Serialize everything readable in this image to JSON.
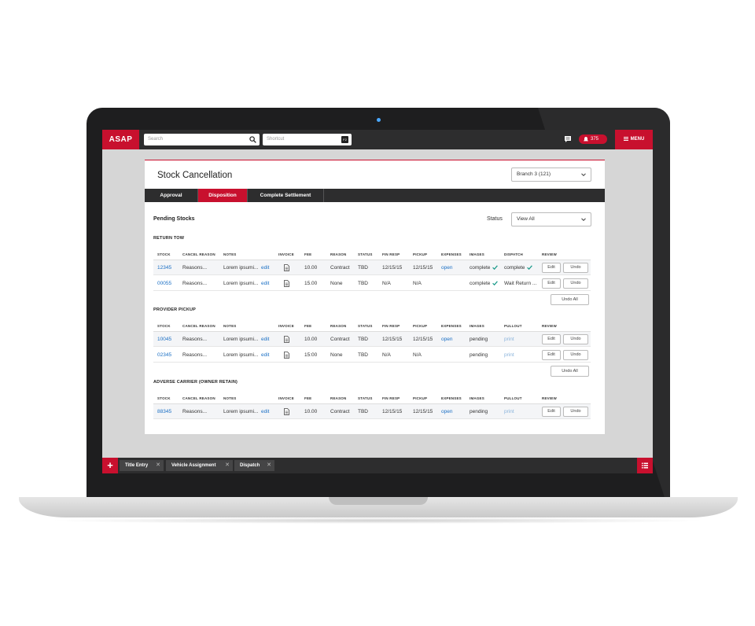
{
  "app": {
    "logo": "ASAP",
    "search_placeholder": "Search",
    "shortcut_placeholder": "Shortcut",
    "shortcut_key": "F2",
    "notification_count": "375",
    "menu_label": "MENU"
  },
  "page": {
    "title": "Stock Cancellation",
    "branch_value": "Branch 3 (121)",
    "tabs": [
      {
        "label": "Approval",
        "active": false
      },
      {
        "label": "Disposition",
        "active": true
      },
      {
        "label": "Complete Settlement",
        "active": false
      }
    ],
    "pending_title": "Pending Stocks",
    "status_label": "Status",
    "status_value": "View All"
  },
  "sections": [
    {
      "title": "RETURN TOW",
      "headers": [
        "STOCK",
        "CANCEL REASON",
        "NOTES",
        "INVOICE",
        "FEE",
        "REASON",
        "STATUS",
        "FIN RESP",
        "PICKUP",
        "EXPENSES",
        "IMAGES",
        "DISPATCH",
        "REVIEW"
      ],
      "rows": [
        {
          "stock": "12345",
          "cancel_reason": "Reasons...",
          "notes": "Lorem ipsumi...",
          "notes_edit": "edit",
          "fee": "10.00",
          "reason": "Contract",
          "status": "TBD",
          "fin_resp": "12/15/15",
          "pickup": "12/15/15",
          "expenses": "open",
          "images": "complete",
          "dispatch": "complete",
          "edit": "Edit",
          "undo": "Undo"
        },
        {
          "stock": "00055",
          "cancel_reason": "Reasons...",
          "notes": "Lorem ipsumi...",
          "notes_edit": "edit",
          "fee": "15.00",
          "reason": "None",
          "status": "TBD",
          "fin_resp": "N/A",
          "pickup": "N/A",
          "expenses": "",
          "images": "complete",
          "dispatch": "Wait Return ...",
          "edit": "Edit",
          "undo": "Undo"
        }
      ],
      "undo_all": "Undo All"
    },
    {
      "title": "PROVIDER PICKUP",
      "headers": [
        "STOCK",
        "CANCEL REASON",
        "NOTES",
        "INVOICE",
        "FEE",
        "REASON",
        "STATUS",
        "FIN RESP",
        "PICKUP",
        "EXPENSES",
        "IMAGES",
        "PULLOUT",
        "REVIEW"
      ],
      "rows": [
        {
          "stock": "10045",
          "cancel_reason": "Reasons...",
          "notes": "Lorem ipsumi...",
          "notes_edit": "edit",
          "fee": "10.00",
          "reason": "Contract",
          "status": "TBD",
          "fin_resp": "12/15/15",
          "pickup": "12/15/15",
          "expenses": "open",
          "images": "pending",
          "pullout": "print",
          "edit": "Edit",
          "undo": "Undo"
        },
        {
          "stock": "02345",
          "cancel_reason": "Reasons...",
          "notes": "Lorem ipsumi...",
          "notes_edit": "edit",
          "fee": "15:00",
          "reason": "None",
          "status": "TBD",
          "fin_resp": "N/A",
          "pickup": "N/A",
          "expenses": "",
          "images": "pending",
          "pullout": "print",
          "edit": "Edit",
          "undo": "Undo"
        }
      ],
      "undo_all": "Undo All"
    },
    {
      "title": "ADVERSE CARRIER (OWNER RETAIN)",
      "headers": [
        "STOCK",
        "CANCEL REASON",
        "NOTES",
        "INVOICE",
        "FEE",
        "REASON",
        "STATUS",
        "FIN RESP",
        "PICKUP",
        "EXPENSES",
        "IMAGES",
        "PULLOUT",
        "REVIEW"
      ],
      "rows": [
        {
          "stock": "88345",
          "cancel_reason": "Reasons...",
          "notes": "Lorem ipsumi...",
          "notes_edit": "edit",
          "fee": "10.00",
          "reason": "Contract",
          "status": "TBD",
          "fin_resp": "12/15/15",
          "pickup": "12/15/15",
          "expenses": "open",
          "images": "pending",
          "pullout": "print",
          "edit": "Edit",
          "undo": "Undo"
        }
      ]
    }
  ],
  "bottom_tabs": [
    "Title Entry",
    "Vehicle Assignment",
    "Dispatch"
  ],
  "colors": {
    "brand_red": "#c8102e",
    "dark_bar": "#2d2d2e",
    "link_blue": "#1a6fc4",
    "check_teal": "#1a9a8a"
  }
}
